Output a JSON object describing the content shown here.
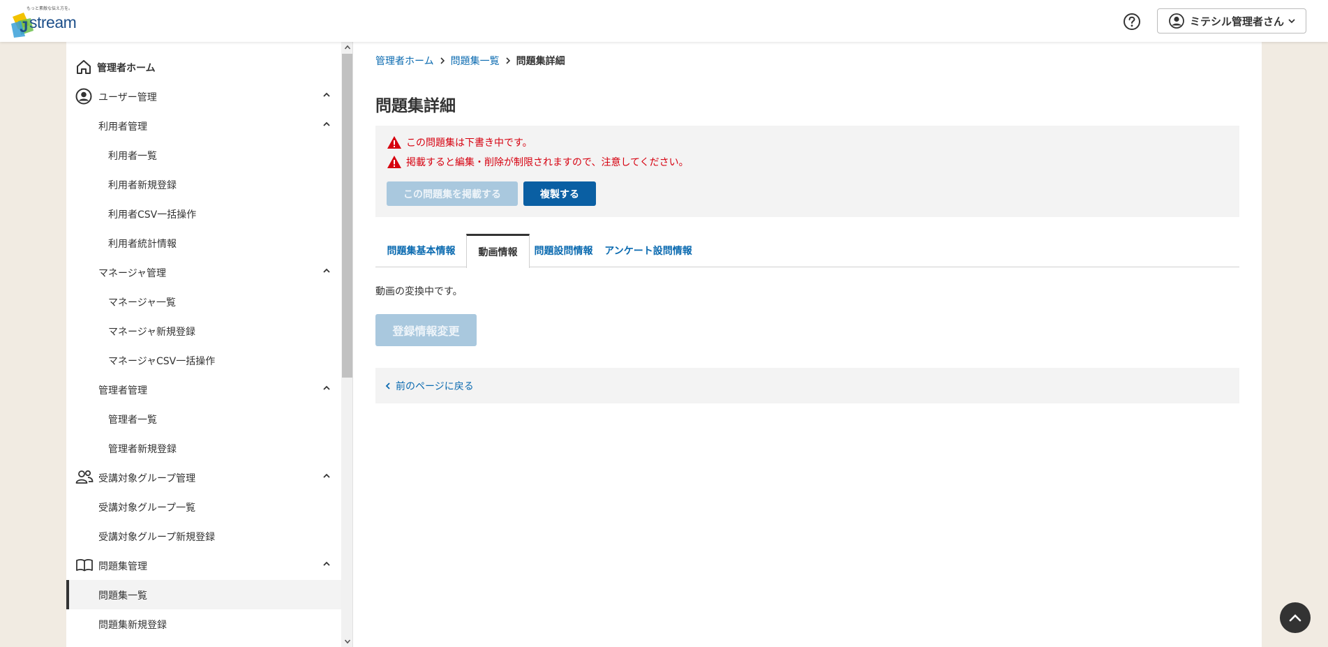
{
  "header": {
    "logo_tagline": "もっと素敵な伝え方を。",
    "logo_text": "stream",
    "user_name": "ミテシル管理者さん"
  },
  "sidebar": {
    "items": [
      {
        "label": "管理者ホーム",
        "level": "top"
      },
      {
        "label": "ユーザー管理",
        "level": "sec"
      },
      {
        "label": "利用者管理",
        "level": "sub"
      },
      {
        "label": "利用者一覧",
        "level": "leaf"
      },
      {
        "label": "利用者新規登録",
        "level": "leaf"
      },
      {
        "label": "利用者CSV一括操作",
        "level": "leaf"
      },
      {
        "label": "利用者統計情報",
        "level": "leaf"
      },
      {
        "label": "マネージャ管理",
        "level": "sub"
      },
      {
        "label": "マネージャ一覧",
        "level": "leaf"
      },
      {
        "label": "マネージャ新規登録",
        "level": "leaf"
      },
      {
        "label": "マネージャCSV一括操作",
        "level": "leaf"
      },
      {
        "label": "管理者管理",
        "level": "sub"
      },
      {
        "label": "管理者一覧",
        "level": "leaf"
      },
      {
        "label": "管理者新規登録",
        "level": "leaf"
      },
      {
        "label": "受講対象グループ管理",
        "level": "sec"
      },
      {
        "label": "受講対象グループ一覧",
        "level": "sub"
      },
      {
        "label": "受講対象グループ新規登録",
        "level": "sub"
      },
      {
        "label": "問題集管理",
        "level": "sec"
      },
      {
        "label": "問題集一覧",
        "level": "sub",
        "active": true
      },
      {
        "label": "問題集新規登録",
        "level": "sub"
      }
    ]
  },
  "breadcrumb": {
    "home": "管理者ホーム",
    "list": "問題集一覧",
    "current": "問題集詳細"
  },
  "page": {
    "title": "問題集詳細",
    "alerts": [
      "この問題集は下書き中です。",
      "掲載すると編集・削除が制限されますので、注意してください。"
    ],
    "publish_button": "この問題集を掲載する",
    "copy_button": "複製する",
    "tabs": [
      "問題集基本情報",
      "動画情報",
      "問題設問情報",
      "アンケート設問情報"
    ],
    "active_tab": "動画情報",
    "status_text": "動画の変換中です。",
    "edit_button": "登録情報変更",
    "back_link": "前のページに戻る"
  },
  "colors": {
    "link": "#0a6ab0",
    "primary": "#0a5fa3",
    "alert": "#d6000f",
    "disabled": "#a9c8de",
    "background": "#f1ebe2"
  }
}
